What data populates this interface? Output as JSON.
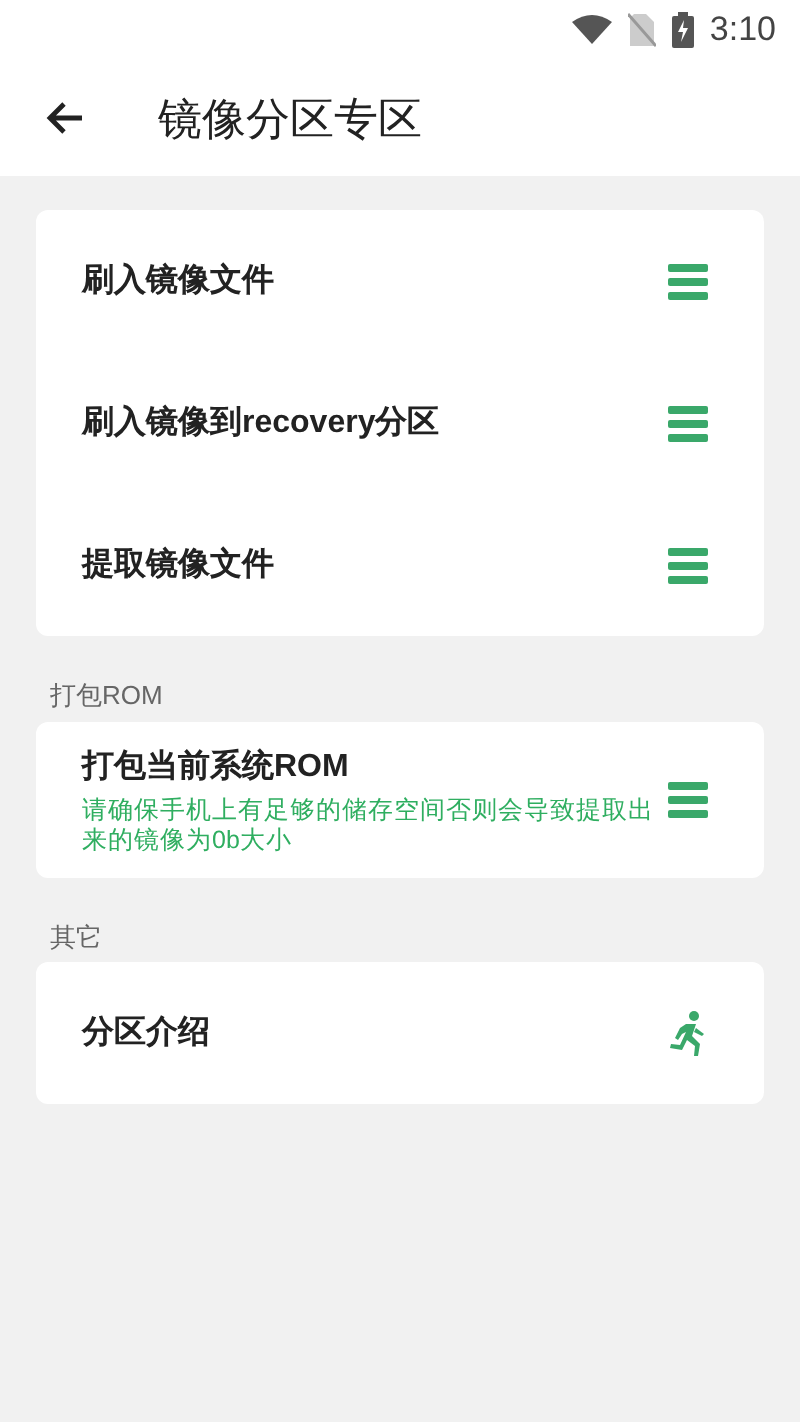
{
  "status_bar": {
    "time": "3:10"
  },
  "header": {
    "title": "镜像分区专区"
  },
  "sections": [
    {
      "items": [
        {
          "title": "刷入镜像文件",
          "kind": "menu"
        },
        {
          "title": "刷入镜像到recovery分区",
          "kind": "menu"
        },
        {
          "title": "提取镜像文件",
          "kind": "menu"
        }
      ]
    },
    {
      "label": "打包ROM",
      "items": [
        {
          "title": "打包当前系统ROM",
          "subtitle": "请确保手机上有足够的储存空间否则会导致提取出来的镜像为0b大小",
          "kind": "menu"
        }
      ]
    },
    {
      "label": "其它",
      "items": [
        {
          "title": "分区介绍",
          "kind": "run"
        }
      ]
    }
  ]
}
